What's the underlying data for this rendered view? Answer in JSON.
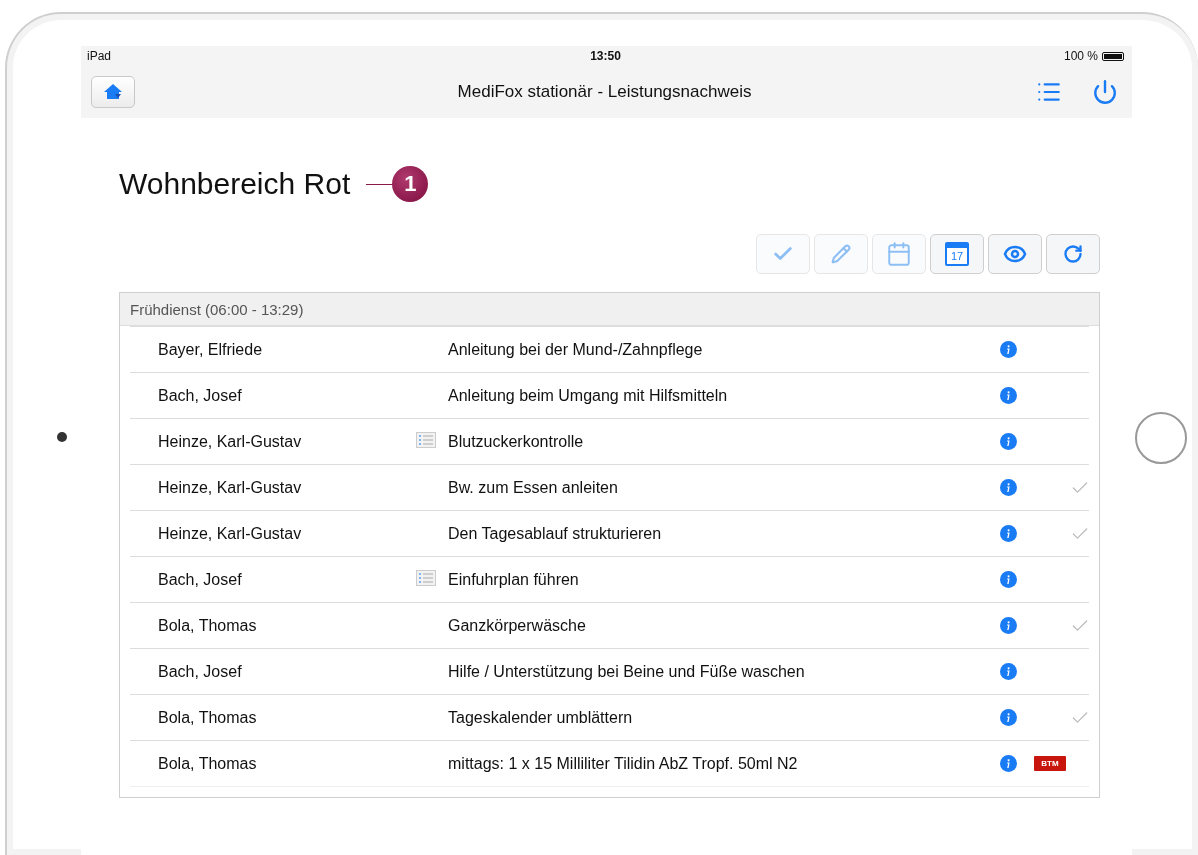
{
  "status_bar": {
    "device": "iPad",
    "time": "13:50",
    "battery": "100 %"
  },
  "nav_bar": {
    "title": "MediFox stationär - Leistungsnachweis"
  },
  "page": {
    "title": "Wohnbereich Rot",
    "callout": "1"
  },
  "toolbar": [
    {
      "kind": "check",
      "disabled": true
    },
    {
      "kind": "pencil",
      "disabled": true
    },
    {
      "kind": "calendar-blank",
      "disabled": true
    },
    {
      "kind": "calendar",
      "disabled": false,
      "label": "17"
    },
    {
      "kind": "eye",
      "disabled": false
    },
    {
      "kind": "refresh",
      "disabled": false
    }
  ],
  "table": {
    "section": "Frühdienst (06:00 - 13:29)",
    "rows": [
      {
        "name": "Bayer, Elfriede",
        "list_icon": false,
        "task": "Anleitung bei der Mund-/Zahnpflege",
        "done": false
      },
      {
        "name": "Bach, Josef",
        "list_icon": false,
        "task": "Anleitung beim Umgang mit Hilfsmitteln",
        "done": false
      },
      {
        "name": "Heinze, Karl-Gustav",
        "list_icon": true,
        "task": "Blutzuckerkontrolle",
        "done": false
      },
      {
        "name": "Heinze, Karl-Gustav",
        "list_icon": false,
        "task": "Bw. zum Essen anleiten",
        "done": true
      },
      {
        "name": "Heinze, Karl-Gustav",
        "list_icon": false,
        "task": "Den Tagesablauf strukturieren",
        "done": true
      },
      {
        "name": "Bach, Josef",
        "list_icon": true,
        "task": "Einfuhrplan führen",
        "done": false
      },
      {
        "name": "Bola, Thomas",
        "list_icon": false,
        "task": "Ganzkörperwäsche",
        "done": true
      },
      {
        "name": "Bach, Josef",
        "list_icon": false,
        "task": "Hilfe / Unterstützung bei Beine und Füße waschen",
        "done": false
      },
      {
        "name": "Bola, Thomas",
        "list_icon": false,
        "task": "Tageskalender umblättern",
        "done": true
      },
      {
        "name": "Bola, Thomas",
        "list_icon": false,
        "task": "mittags: 1 x 15 Milliliter Tilidin AbZ Tropf. 50ml N2",
        "done": false,
        "badge": "BTM"
      }
    ]
  }
}
